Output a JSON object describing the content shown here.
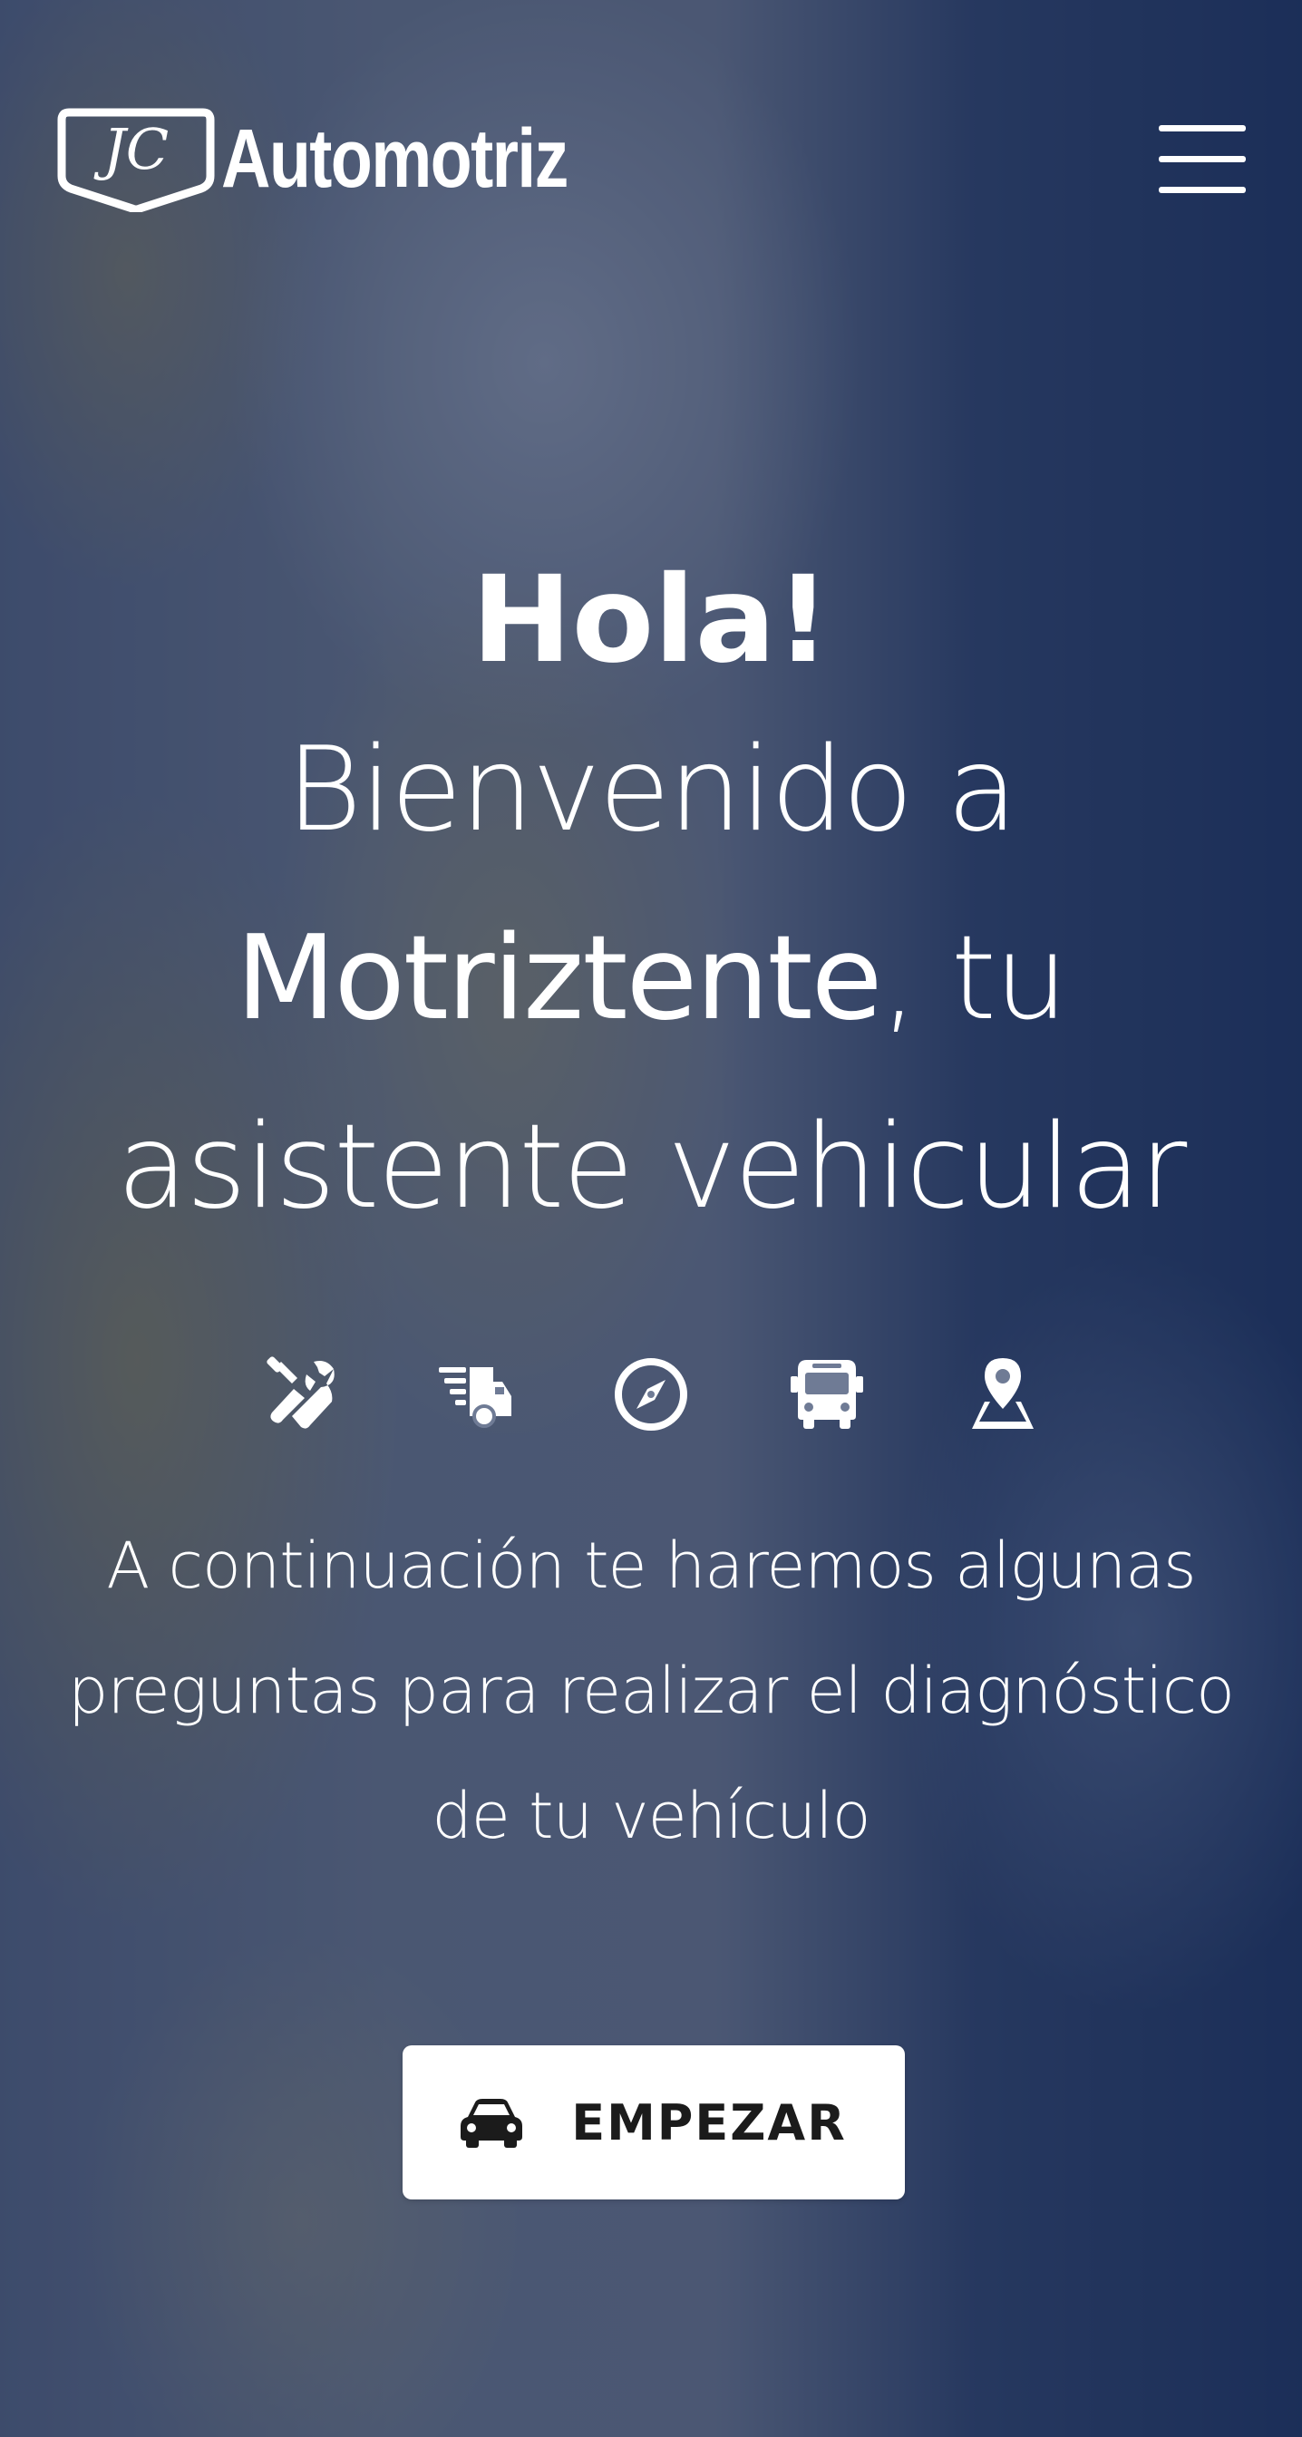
{
  "header": {
    "logo_monogram": "JC",
    "logo_text": "Automotriz",
    "menu_icon": "hamburger-menu-icon"
  },
  "hero": {
    "greeting": "Hola!",
    "welcome_prefix": "Bienvenido a",
    "brand_name": "Motriztente",
    "welcome_suffix": ", tu asistente vehicular"
  },
  "service_icons": [
    "tools-icon",
    "fast-truck-icon",
    "compass-icon",
    "bus-icon",
    "map-marker-icon"
  ],
  "intro_text": "A continuación te haremos algunas preguntas para realizar el diagnóstico de tu vehículo",
  "start_button": {
    "icon": "car-icon",
    "label": "EMPEZAR"
  },
  "colors": {
    "overlay": "#1a2d5c",
    "text": "#ffffff",
    "button_bg": "#ffffff",
    "button_text": "#1b1b1b"
  }
}
